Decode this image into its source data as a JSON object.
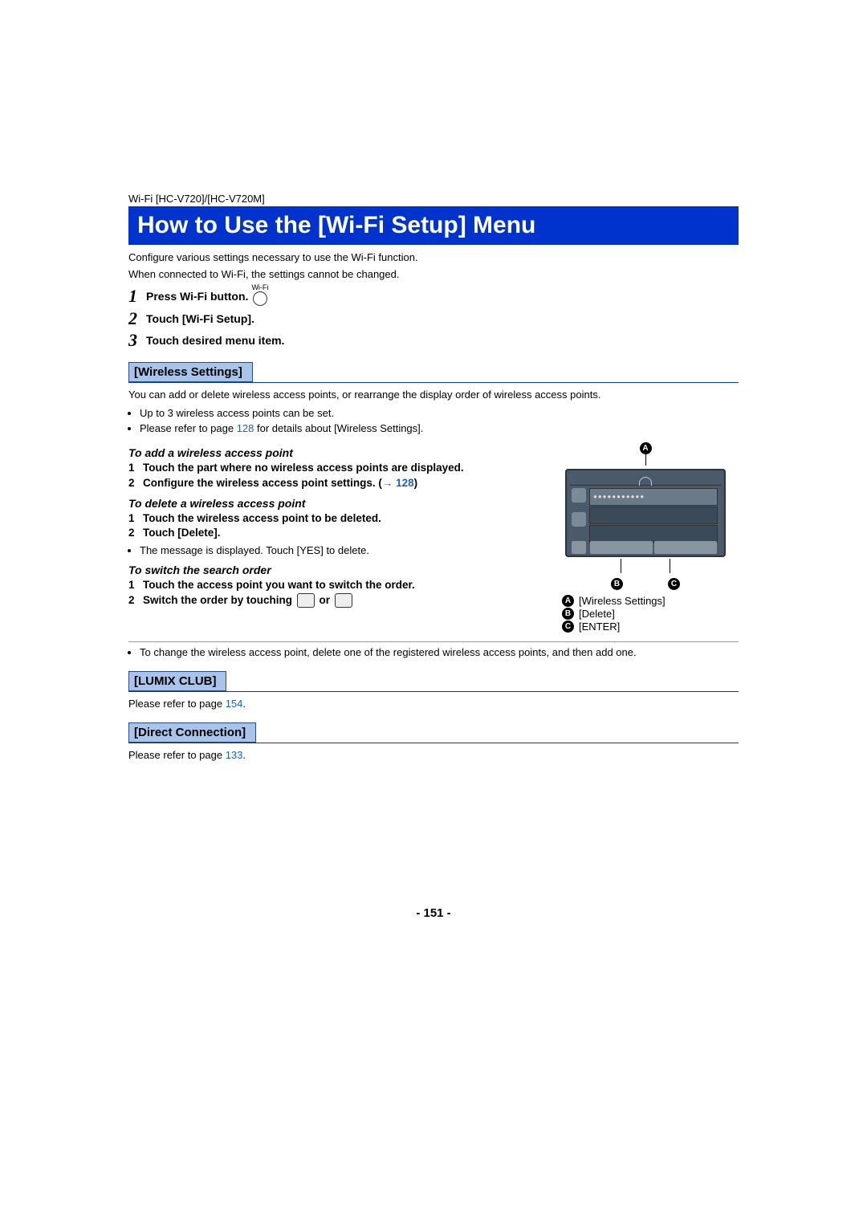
{
  "header": "Wi-Fi [HC-V720]/[HC-V720M]",
  "title": "How to Use the [Wi-Fi Setup] Menu",
  "intro1": "Configure various settings necessary to use the Wi-Fi function.",
  "intro2": "When connected to Wi-Fi, the settings cannot be changed.",
  "steps": [
    {
      "n": "1",
      "text": "Press Wi-Fi button.",
      "wifi_label": "Wi-Fi"
    },
    {
      "n": "2",
      "text": "Touch [Wi-Fi Setup]."
    },
    {
      "n": "3",
      "text": "Touch desired menu item."
    }
  ],
  "wireless": {
    "tab": "[Wireless Settings]",
    "desc": "You can add or delete wireless access points, or rearrange the display order of wireless access points.",
    "bullets": [
      {
        "pre": "Up to 3 wireless access points can be set."
      },
      {
        "pre": "Please refer to page ",
        "link": "128",
        "post": " for details about [Wireless Settings]."
      }
    ],
    "add": {
      "title": "To add a wireless access point",
      "s1": "Touch the part where no wireless access points are displayed.",
      "s2_pre": "Configure the wireless access point settings. (",
      "s2_arrow": "→ ",
      "s2_link": "128",
      "s2_post": ")"
    },
    "del": {
      "title": "To delete a wireless access point",
      "s1": "Touch the wireless access point to be deleted.",
      "s2": "Touch [Delete].",
      "note": "The message is displayed. Touch [YES] to delete."
    },
    "switch": {
      "title": "To switch the search order",
      "s1": "Touch the access point you want to switch the order.",
      "s2_pre": "Switch the order by touching ",
      "s2_mid": " or "
    },
    "foot": "To change the wireless access point, delete one of the registered wireless access points, and then add one.",
    "callouts": {
      "A": "A",
      "B": "B",
      "C": "C"
    },
    "legend": {
      "A": "[Wireless Settings]",
      "B": "[Delete]",
      "C": "[ENTER]"
    }
  },
  "lumix": {
    "tab": "[LUMIX CLUB]",
    "text_pre": "Please refer to page ",
    "link": "154",
    "text_post": "."
  },
  "direct": {
    "tab": "[Direct Connection]",
    "text_pre": "Please refer to page ",
    "link": "133",
    "text_post": "."
  },
  "page_number": "- 151 -"
}
